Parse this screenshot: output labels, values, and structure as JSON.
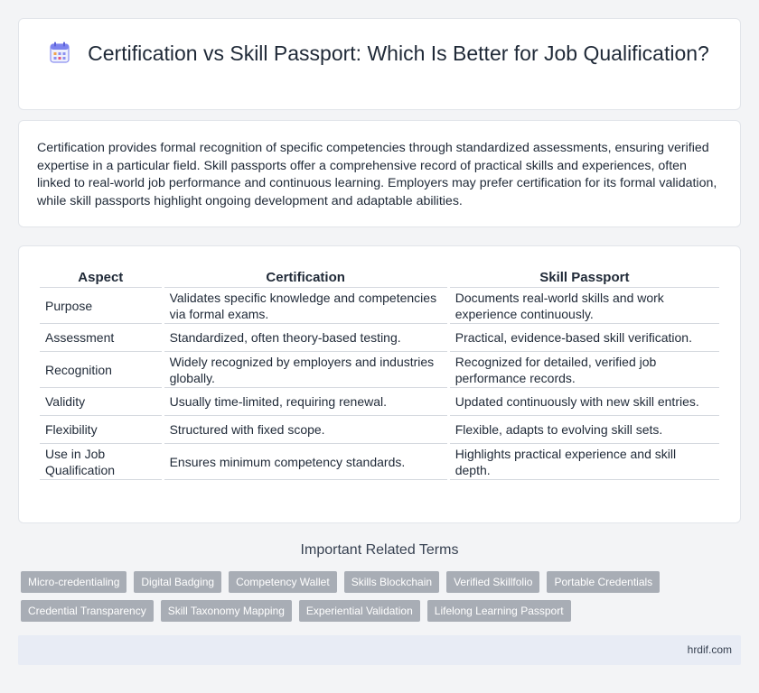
{
  "header": {
    "icon": "calendar-icon",
    "title": "Certification vs Skill Passport: Which Is Better for Job Qualification?"
  },
  "intro": {
    "text": "Certification provides formal recognition of specific competencies through standardized assessments, ensuring verified expertise in a particular field. Skill passports offer a comprehensive record of practical skills and experiences, often linked to real-world job performance and continuous learning. Employers may prefer certification for its formal validation, while skill passports highlight ongoing development and adaptable abilities."
  },
  "table": {
    "headers": [
      "Aspect",
      "Certification",
      "Skill Passport"
    ],
    "rows": [
      [
        "Purpose",
        "Validates specific knowledge and competencies via formal exams.",
        "Documents real-world skills and work experience continuously."
      ],
      [
        "Assessment",
        "Standardized, often theory-based testing.",
        "Practical, evidence-based skill verification."
      ],
      [
        "Recognition",
        "Widely recognized by employers and industries globally.",
        "Recognized for detailed, verified job performance records."
      ],
      [
        "Validity",
        "Usually time-limited, requiring renewal.",
        "Updated continuously with new skill entries."
      ],
      [
        "Flexibility",
        "Structured with fixed scope.",
        "Flexible, adapts to evolving skill sets."
      ],
      [
        "Use in Job Qualification",
        "Ensures minimum competency standards.",
        "Highlights practical experience and skill depth."
      ]
    ]
  },
  "related": {
    "title": "Important Related Terms",
    "tags": [
      "Micro-credentialing",
      "Digital Badging",
      "Competency Wallet",
      "Skills Blockchain",
      "Verified Skillfolio",
      "Portable Credentials",
      "Credential Transparency",
      "Skill Taxonomy Mapping",
      "Experiential Validation",
      "Lifelong Learning Passport"
    ]
  },
  "footer": {
    "site": "hrdif.com"
  },
  "colors": {
    "accent": "#6366f1",
    "tag_bg": "#a8adb5",
    "footer_bg": "#e8ecf5"
  }
}
